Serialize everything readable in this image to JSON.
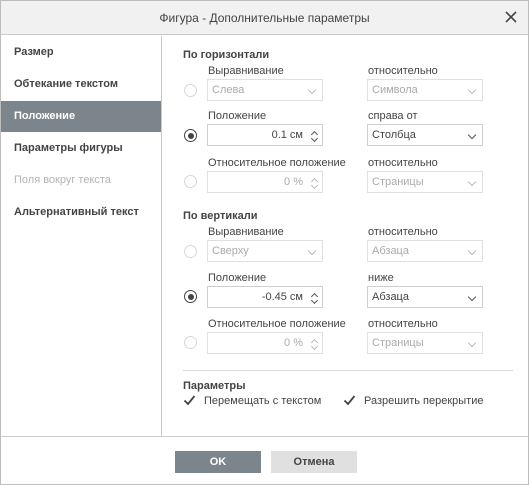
{
  "dialog": {
    "title": "Фигура - Дополнительные параметры"
  },
  "sidebar": {
    "items": [
      {
        "label": "Размер"
      },
      {
        "label": "Обтекание текстом"
      },
      {
        "label": "Положение"
      },
      {
        "label": "Параметры фигуры"
      },
      {
        "label": "Поля вокруг текста"
      },
      {
        "label": "Альтернативный текст"
      }
    ],
    "active_index": 2,
    "disabled_index": 4
  },
  "horizontal": {
    "title": "По горизонтали",
    "alignment_label": "Выравнивание",
    "alignment_value": "Слева",
    "relative_label": "относительно",
    "relative_value": "Символа",
    "position_label": "Положение",
    "position_value": "0.1 см",
    "position_ref_label": "справа от",
    "position_ref_value": "Столбца",
    "relpos_label": "Относительное положение",
    "relpos_value": "0 %",
    "relpos_ref_label": "относительно",
    "relpos_ref_value": "Страницы",
    "selected": "position"
  },
  "vertical": {
    "title": "По вертикали",
    "alignment_label": "Выравнивание",
    "alignment_value": "Сверху",
    "relative_label": "относительно",
    "relative_value": "Абзаца",
    "position_label": "Положение",
    "position_value": "-0.45 см",
    "position_ref_label": "ниже",
    "position_ref_value": "Абзаца",
    "relpos_label": "Относительное положение",
    "relpos_value": "0 %",
    "relpos_ref_label": "относительно",
    "relpos_ref_value": "Страницы",
    "selected": "position"
  },
  "params": {
    "title": "Параметры",
    "move_with_text": "Перемещать с текстом",
    "move_with_text_checked": true,
    "allow_overlap": "Разрешить перекрытие",
    "allow_overlap_checked": true
  },
  "footer": {
    "ok": "OK",
    "cancel": "Отмена"
  }
}
